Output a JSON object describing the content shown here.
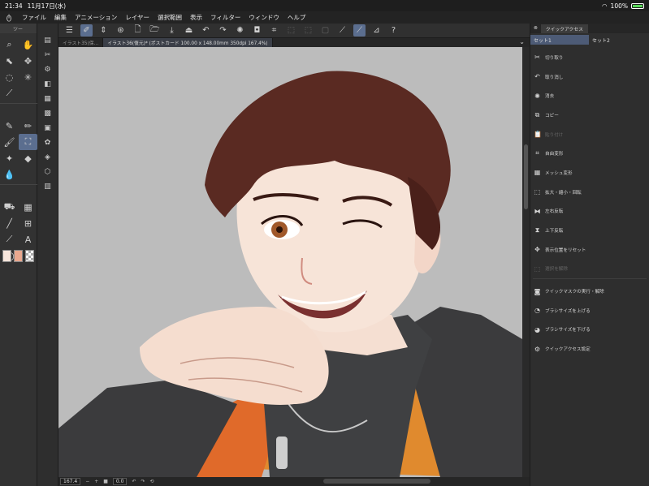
{
  "status_bar": {
    "time": "21:34",
    "date": "11月17日(水)",
    "battery": "100%"
  },
  "menu": [
    "ファイル",
    "編集",
    "アニメーション",
    "レイヤー",
    "選択範囲",
    "表示",
    "フィルター",
    "ウィンドウ",
    "ヘルプ"
  ],
  "tool_palette": {
    "header": "ツー"
  },
  "doc_tabs": [
    {
      "label": "イラスト35(保…"
    },
    {
      "label": "イラスト36(復元)* (ポストカード 100.00 x 148.00mm 350dpi 167.4%)"
    }
  ],
  "nav": {
    "zoom": "167.4",
    "angle": "0.0"
  },
  "quick_access": {
    "title": "クイックアクセス",
    "sets": [
      "セット1",
      "セット2"
    ],
    "items": [
      {
        "label": "切り取り",
        "icon": "scissors-icon",
        "enabled": true
      },
      {
        "label": "取り消し",
        "icon": "undo-icon",
        "enabled": true
      },
      {
        "label": "消去",
        "icon": "clear-icon",
        "enabled": true
      },
      {
        "label": "コピー",
        "icon": "copy-icon",
        "enabled": true
      },
      {
        "label": "貼り付け",
        "icon": "paste-icon",
        "enabled": false
      },
      {
        "label": "自由変形",
        "icon": "free-transform-icon",
        "enabled": true
      },
      {
        "label": "メッシュ変形",
        "icon": "mesh-transform-icon",
        "enabled": true
      },
      {
        "label": "拡大・縮小・回転",
        "icon": "scale-rotate-icon",
        "enabled": true
      },
      {
        "label": "左右反転",
        "icon": "flip-horizontal-icon",
        "enabled": true
      },
      {
        "label": "上下反転",
        "icon": "flip-vertical-icon",
        "enabled": true
      },
      {
        "label": "表示位置をリセット",
        "icon": "reset-view-icon",
        "enabled": true
      },
      {
        "label": "選択を解除",
        "icon": "deselect-icon",
        "enabled": false
      },
      {
        "label": "クイックマスクの実行・解除",
        "icon": "quick-mask-icon",
        "enabled": true
      },
      {
        "label": "ブラシサイズを上げる",
        "icon": "brush-size-up-icon",
        "enabled": true
      },
      {
        "label": "ブラシサイズを下げる",
        "icon": "brush-size-down-icon",
        "enabled": true
      },
      {
        "label": "クイックアクセス設定",
        "icon": "settings-icon",
        "enabled": true
      }
    ]
  },
  "colors": {
    "main": "#f7e6dc",
    "sub": "#e9a88f",
    "accent": "#5b6e8f"
  }
}
